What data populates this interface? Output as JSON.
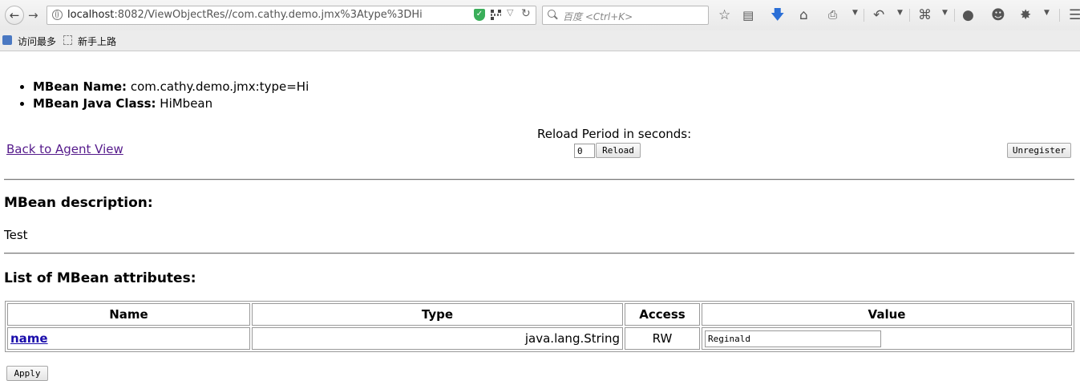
{
  "browser": {
    "url_host": "localhost",
    "url_rest": ":8082/ViewObjectRes//com.cathy.demo.jmx%3Atype%3DHi",
    "search_placeholder": "百度 <Ctrl+K>",
    "bookmarks": [
      "访问最多",
      "新手上路"
    ]
  },
  "mbean": {
    "name_label": "MBean Name:",
    "name_value": "com.cathy.demo.jmx:type=Hi",
    "class_label": "MBean Java Class:",
    "class_value": "HiMbean"
  },
  "controls": {
    "back_link": "Back to Agent View",
    "reload_label": "Reload Period in seconds:",
    "reload_value": "0",
    "reload_button": "Reload",
    "unregister_button": "Unregister"
  },
  "description": {
    "heading": "MBean description:",
    "text": "Test"
  },
  "attributes": {
    "heading": "List of MBean attributes:",
    "columns": [
      "Name",
      "Type",
      "Access",
      "Value"
    ],
    "rows": [
      {
        "name": "name",
        "type": "java.lang.String",
        "access": "RW",
        "value": "Reginald"
      }
    ],
    "apply_button": "Apply"
  }
}
